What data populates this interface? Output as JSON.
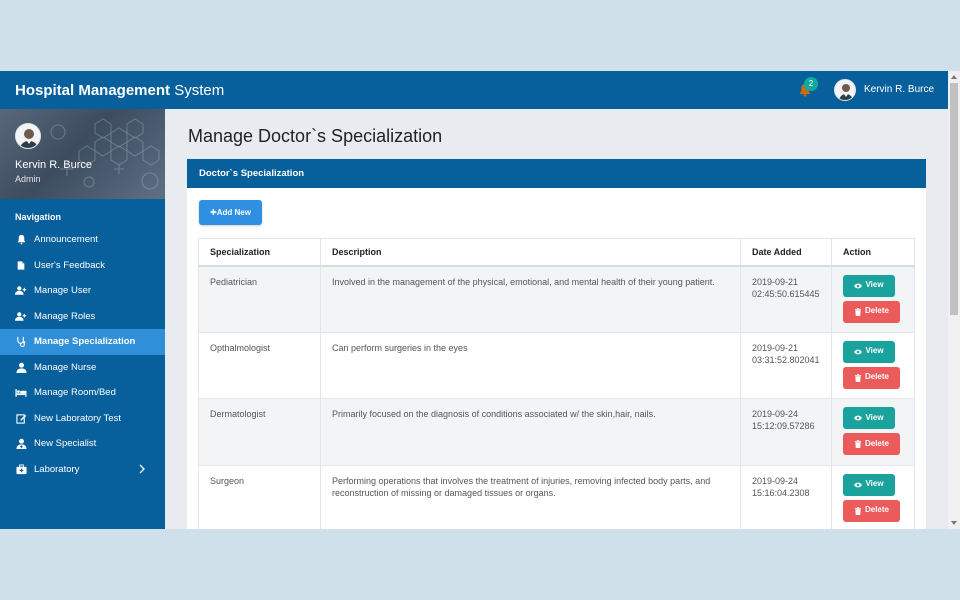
{
  "header": {
    "brand_bold": "Hospital Management",
    "brand_light": " System",
    "notification_count": "2",
    "user_name": "Kervin R. Burce"
  },
  "sidebar": {
    "profile_name": "Kervin R. Burce",
    "profile_role": "Admin",
    "nav_heading": "Navigation",
    "items": [
      {
        "label": "Announcement",
        "icon": "bell-icon"
      },
      {
        "label": "User's Feedback",
        "icon": "document-icon"
      },
      {
        "label": "Manage User",
        "icon": "user-plus-icon"
      },
      {
        "label": "Manage Roles",
        "icon": "user-plus-icon"
      },
      {
        "label": "Manage Specialization",
        "icon": "stethoscope-icon",
        "active": true
      },
      {
        "label": "Manage Nurse",
        "icon": "user-icon"
      },
      {
        "label": "Manage Room/Bed",
        "icon": "bed-icon"
      },
      {
        "label": "New Laboratory Test",
        "icon": "edit-icon"
      },
      {
        "label": "New Specialist",
        "icon": "user-doctor-icon"
      },
      {
        "label": "Laboratory",
        "icon": "medkit-icon"
      }
    ]
  },
  "main": {
    "page_title": "Manage Doctor`s Specialization",
    "panel_title": "Doctor`s Specialization",
    "add_button": "Add New",
    "columns": [
      "Specialization",
      "Description",
      "Date Added",
      "Action"
    ],
    "rows": [
      {
        "specialization": "Pediatrician",
        "description": "Involved in the management of the physical, emotional, and mental health of their young patient.",
        "date": "2019-09-21 02:45:50.615445"
      },
      {
        "specialization": "Opthalmologist",
        "description": "Can perform surgeries in the eyes",
        "date": "2019-09-21 03:31:52.802041"
      },
      {
        "specialization": "Dermatologist",
        "description": "Primarily focused on the diagnosis of conditions associated w/ the skin,hair, nails.",
        "date": "2019-09-24 15:12:09.57286"
      },
      {
        "specialization": "Surgeon",
        "description": "Performing operations that involves the treatment of injuries, removing infected body parts, and reconstruction of missing or damaged tissues or organs.",
        "date": "2019-09-24 15:16:04.2308"
      }
    ],
    "view_label": "View",
    "delete_label": "Delete"
  },
  "colors": {
    "primary": "#075f9c",
    "active_nav": "#2f8fd8",
    "view": "#1aa39d",
    "delete": "#eb5b5b",
    "add": "#2f8fe2"
  }
}
